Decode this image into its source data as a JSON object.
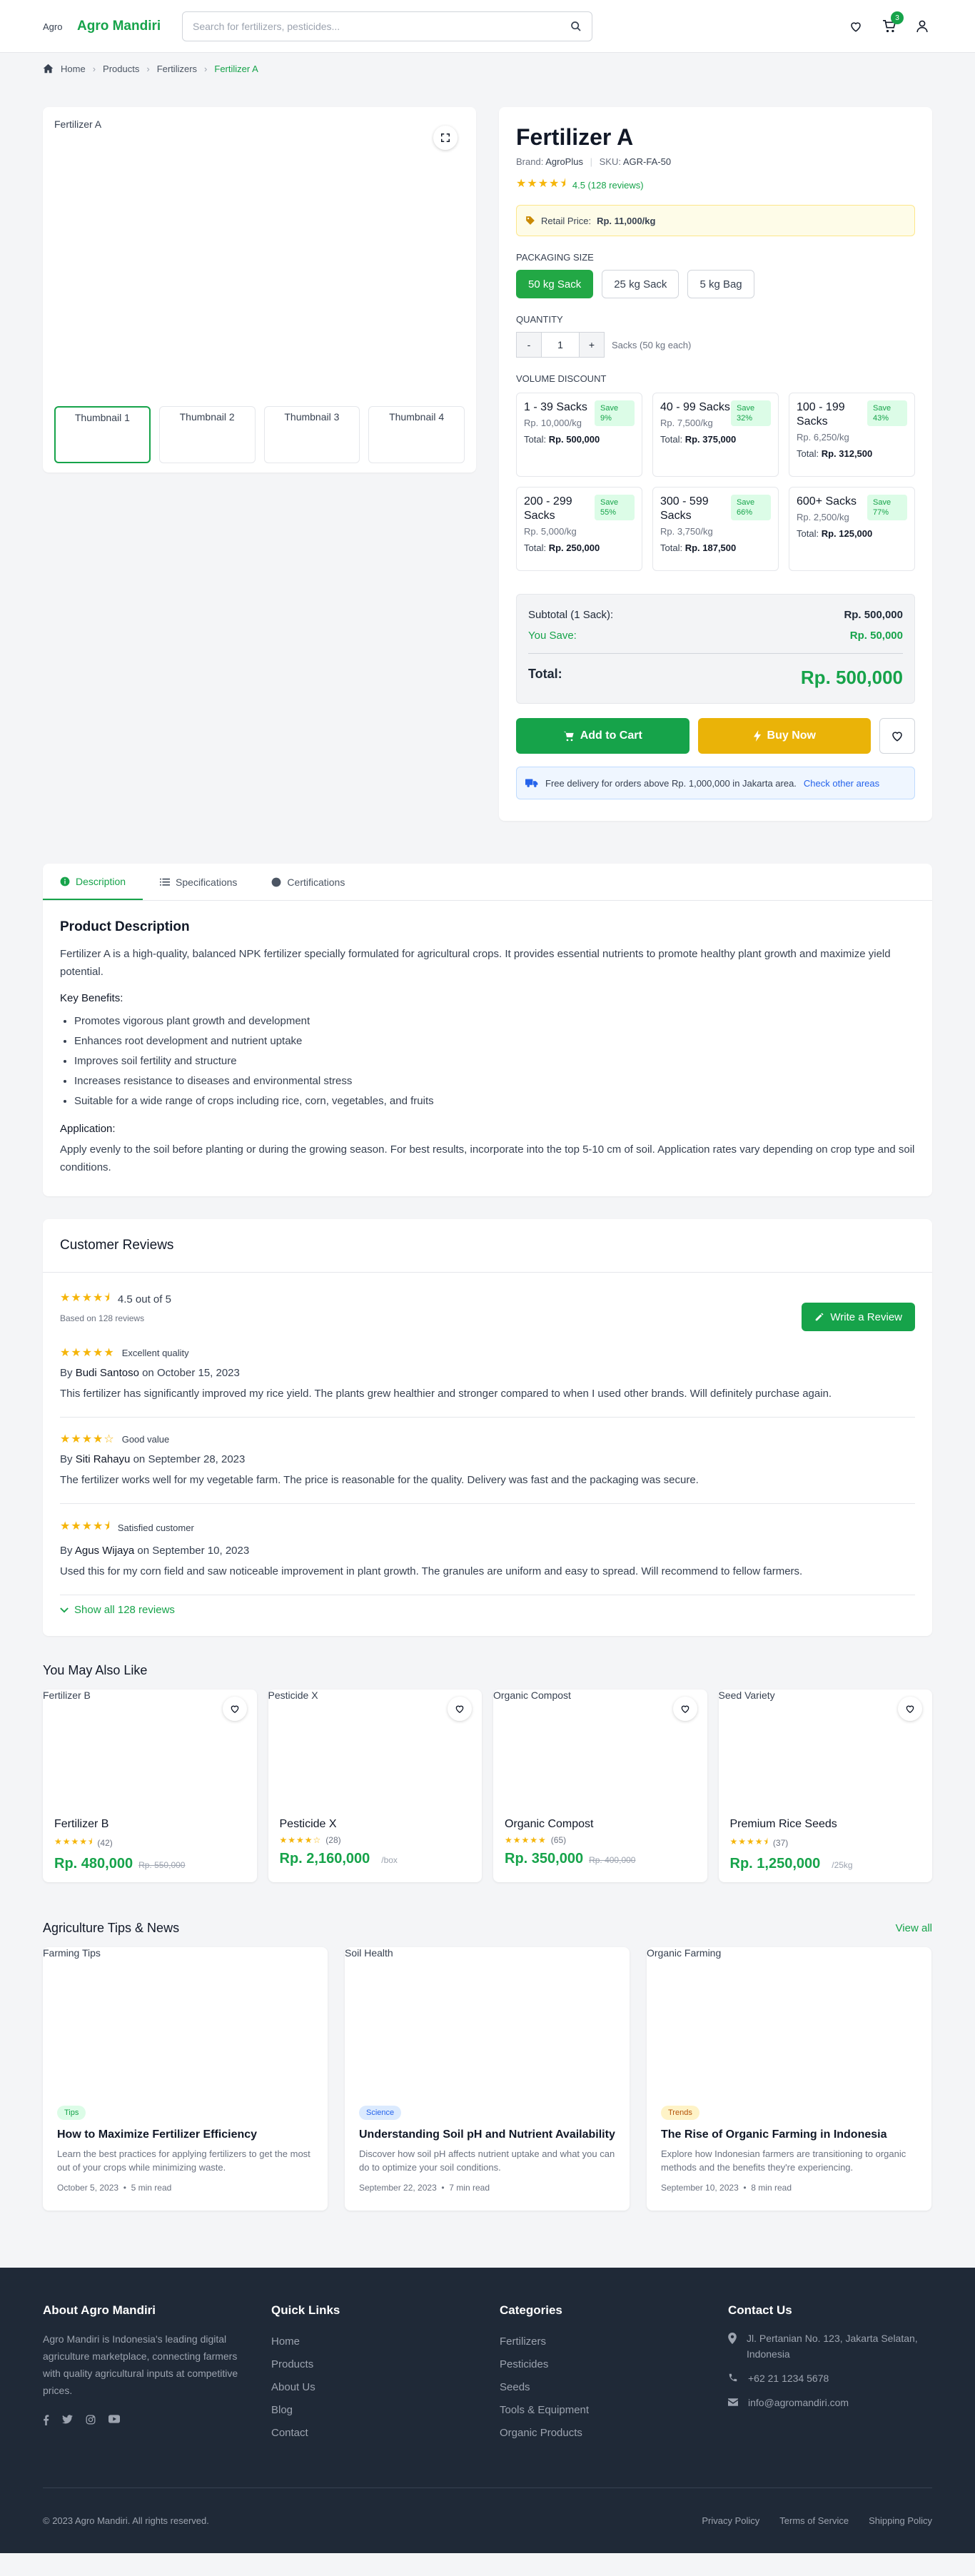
{
  "header": {
    "logo_alt": "Agro",
    "brand": "Agro Mandiri",
    "search_placeholder": "Search for fertilizers, pesticides...",
    "cart_count": "3"
  },
  "breadcrumb": [
    "Home",
    "Products",
    "Fertilizers",
    "Fertilizer A"
  ],
  "gallery": {
    "main_alt": "Fertilizer A",
    "thumbs": [
      "Thumbnail 1",
      "Thumbnail 2",
      "Thumbnail 3",
      "Thumbnail 4"
    ]
  },
  "product": {
    "title": "Fertilizer A",
    "brand_label": "Brand:",
    "brand": "AgroPlus",
    "sku_label": "SKU:",
    "sku": "AGR-FA-50",
    "stars": "★★★★⯨",
    "rating_text": "4.5 (128 reviews)",
    "retail_label": "Retail Price:",
    "retail_value": "Rp. 11,000/kg",
    "packaging_label": "PACKAGING SIZE",
    "packaging": [
      "50 kg Sack",
      "25 kg Sack",
      "5 kg Bag"
    ],
    "quantity_label": "QUANTITY",
    "qty_minus": "-",
    "qty_plus": "+",
    "quantity": "1",
    "qty_note": "Sacks (50 kg each)",
    "volume_label": "VOLUME DISCOUNT",
    "total_prefix": "Total:",
    "tiers": [
      {
        "range": "1 - 39 Sacks",
        "save": "Save 9%",
        "price": "Rp. 10,000/kg",
        "total": "Rp. 500,000"
      },
      {
        "range": "40 - 99 Sacks",
        "save": "Save 32%",
        "price": "Rp. 7,500/kg",
        "total": "Rp. 375,000"
      },
      {
        "range": "100 - 199 Sacks",
        "save": "Save 43%",
        "price": "Rp. 6,250/kg",
        "total": "Rp. 312,500"
      },
      {
        "range": "200 - 299 Sacks",
        "save": "Save 55%",
        "price": "Rp. 5,000/kg",
        "total": "Rp. 250,000"
      },
      {
        "range": "300 - 599 Sacks",
        "save": "Save 66%",
        "price": "Rp. 3,750/kg",
        "total": "Rp. 187,500"
      },
      {
        "range": "600+ Sacks",
        "save": "Save 77%",
        "price": "Rp. 2,500/kg",
        "total": "Rp. 125,000"
      }
    ],
    "subtotal_label": "Subtotal (1 Sack):",
    "subtotal": "Rp. 500,000",
    "you_save_label": "You Save:",
    "you_save": "Rp. 50,000",
    "total_label": "Total:",
    "total": "Rp. 500,000",
    "add_to_cart": "Add to Cart",
    "buy_now": "Buy Now",
    "delivery_text": "Free delivery for orders above Rp. 1,000,000 in Jakarta area.",
    "delivery_link": "Check other areas"
  },
  "tabs": [
    "Description",
    "Specifications",
    "Certifications"
  ],
  "description": {
    "title": "Product Description",
    "intro": "Fertilizer A is a high-quality, balanced NPK fertilizer specially formulated for agricultural crops. It provides essential nutrients to promote healthy plant growth and maximize yield potential.",
    "benefits_title": "Key Benefits:",
    "benefits": [
      "Promotes vigorous plant growth and development",
      "Enhances root development and nutrient uptake",
      "Improves soil fertility and structure",
      "Increases resistance to diseases and environmental stress",
      "Suitable for a wide range of crops including rice, corn, vegetables, and fruits"
    ],
    "application_title": "Application:",
    "application": "Apply evenly to the soil before planting or during the growing season. For best results, incorporate into the top 5-10 cm of soil. Application rates vary depending on crop type and soil conditions."
  },
  "reviews": {
    "title": "Customer Reviews",
    "stars": "★★★★⯨",
    "average": "4.5 out of 5",
    "based_on": "Based on 128 reviews",
    "write_review": "Write a Review",
    "by_prefix": "By",
    "on_word": "on",
    "items": [
      {
        "stars": "★★★★★",
        "title": "Excellent quality",
        "author": "Budi Santoso",
        "date": "October 15, 2023",
        "text": "This fertilizer has significantly improved my rice yield. The plants grew healthier and stronger compared to when I used other brands. Will definitely purchase again."
      },
      {
        "stars": "★★★★☆",
        "title": "Good value",
        "author": "Siti Rahayu",
        "date": "September 28, 2023",
        "text": "The fertilizer works well for my vegetable farm. The price is reasonable for the quality. Delivery was fast and the packaging was secure."
      },
      {
        "stars": "★★★★⯨",
        "title": "Satisfied customer",
        "author": "Agus Wijaya",
        "date": "September 10, 2023",
        "text": "Used this for my corn field and saw noticeable improvement in plant growth. The granules are uniform and easy to spread. Will recommend to fellow farmers."
      }
    ],
    "show_all": "Show all 128 reviews"
  },
  "related": {
    "title": "You May Also Like",
    "items": [
      {
        "alt": "Fertilizer B",
        "name": "Fertilizer B",
        "stars": "★★★★⯨",
        "count": "(42)",
        "price": "Rp. 480,000",
        "old": "Rp. 550,000",
        "unit": ""
      },
      {
        "alt": "Pesticide X",
        "name": "Pesticide X",
        "stars": "★★★★☆",
        "count": "(28)",
        "price": "Rp. 2,160,000",
        "old": "",
        "unit": "/box"
      },
      {
        "alt": "Organic Compost",
        "name": "Organic Compost",
        "stars": "★★★★★",
        "count": "(65)",
        "price": "Rp. 350,000",
        "old": "Rp. 400,000",
        "unit": ""
      },
      {
        "alt": "Seed Variety",
        "name": "Premium Rice Seeds",
        "stars": "★★★★⯨",
        "count": "(37)",
        "price": "Rp. 1,250,000",
        "old": "",
        "unit": "/25kg"
      }
    ]
  },
  "tips": {
    "title": "Agriculture Tips & News",
    "view_all": "View all",
    "items": [
      {
        "alt": "Farming Tips",
        "tag": "Tips",
        "tag_bg": "#dcfce7",
        "tag_color": "#16a34a",
        "title": "How to Maximize Fertilizer Efficiency",
        "text": "Learn the best practices for applying fertilizers to get the most out of your crops while minimizing waste.",
        "date": "October 5, 2023",
        "read": "5 min read"
      },
      {
        "alt": "Soil Health",
        "tag": "Science",
        "tag_bg": "#dbeafe",
        "tag_color": "#2563eb",
        "title": "Understanding Soil pH and Nutrient Availability",
        "text": "Discover how soil pH affects nutrient uptake and what you can do to optimize your soil conditions.",
        "date": "September 22, 2023",
        "read": "7 min read"
      },
      {
        "alt": "Organic Farming",
        "tag": "Trends",
        "tag_bg": "#fef3c7",
        "tag_color": "#b45309",
        "title": "The Rise of Organic Farming in Indonesia",
        "text": "Explore how Indonesian farmers are transitioning to organic methods and the benefits they're experiencing.",
        "date": "September 10, 2023",
        "read": "8 min read"
      }
    ]
  },
  "footer": {
    "about_title": "About Agro Mandiri",
    "about_text": "Agro Mandiri is Indonesia's leading digital agriculture marketplace, connecting farmers with quality agricultural inputs at competitive prices.",
    "quick_title": "Quick Links",
    "quick": [
      "Home",
      "Products",
      "About Us",
      "Blog",
      "Contact"
    ],
    "cat_title": "Categories",
    "categories": [
      "Fertilizers",
      "Pesticides",
      "Seeds",
      "Tools & Equipment",
      "Organic Products"
    ],
    "contact_title": "Contact Us",
    "address": "Jl. Pertanian No. 123, Jakarta Selatan, Indonesia",
    "phone": "+62 21 1234 5678",
    "email": "info@agromandiri.com",
    "copyright": "© 2023 Agro Mandiri. All rights reserved.",
    "legal": [
      "Privacy Policy",
      "Terms of Service",
      "Shipping Policy"
    ]
  },
  "colors": {
    "primary": "#16a34a",
    "accent": "#eab308",
    "footer": "#1f2937"
  }
}
